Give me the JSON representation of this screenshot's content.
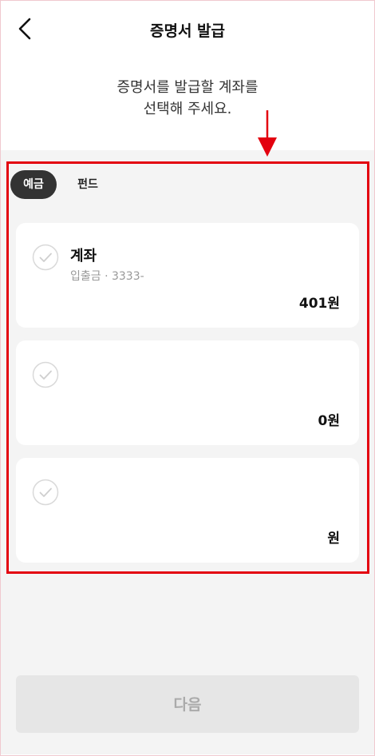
{
  "header": {
    "title": "증명서 발급"
  },
  "instruction": {
    "line1": "증명서를 발급할 계좌를",
    "line2": "선택해 주세요."
  },
  "tabs": [
    {
      "label": "예금",
      "selected": true
    },
    {
      "label": "펀드",
      "selected": false
    }
  ],
  "accounts": [
    {
      "name": "계좌",
      "subtitle": "입출금 · 3333-",
      "amount": "401원"
    },
    {
      "name": "",
      "subtitle": "",
      "amount": "0원"
    },
    {
      "name": "",
      "subtitle": "",
      "amount": "원"
    }
  ],
  "next_button": {
    "label": "다음",
    "enabled": false
  },
  "colors": {
    "highlight": "#e3000f",
    "tab_selected_bg": "#333333",
    "background": "#f4f4f4",
    "button_disabled": "#e6e6e6"
  },
  "icons": {
    "back": "chevron-left-icon",
    "check": "check-circle-icon",
    "arrow": "arrow-down-icon"
  }
}
